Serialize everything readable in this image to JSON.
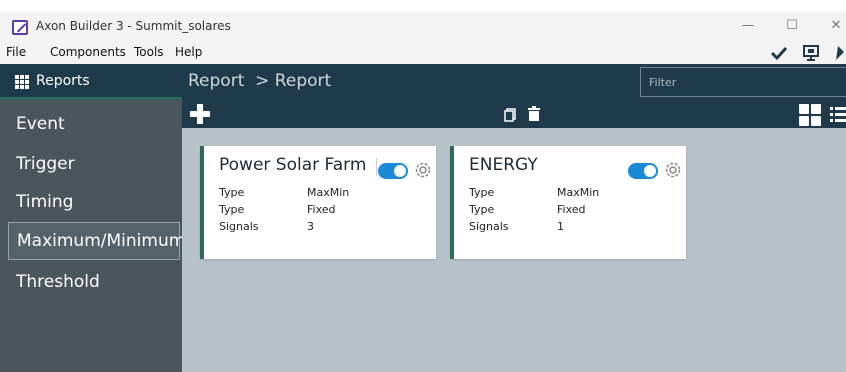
{
  "window": {
    "title": "Axon Builder 3 - Summit_solares",
    "minimize": "—",
    "maximize": "☐",
    "close": "✕"
  },
  "menu": {
    "items": [
      "File",
      "Components",
      "Tools",
      "Help"
    ],
    "tools": [
      "check-icon",
      "monitor-icon",
      "pin-icon"
    ]
  },
  "sidebar": {
    "title": "Reports",
    "items": [
      {
        "label": "Event"
      },
      {
        "label": "Trigger"
      },
      {
        "label": "Timing"
      },
      {
        "label": "Maximum/Minimum",
        "active": true
      },
      {
        "label": "Threshold"
      }
    ]
  },
  "header": {
    "breadcrumb": "Report  > Report",
    "filter_placeholder": "Filter"
  },
  "cards": [
    {
      "title": "Power Solar Farm",
      "enabled": true,
      "rows": [
        {
          "key": "Type",
          "value": "MaxMin"
        },
        {
          "key": "Type",
          "value": "Fixed"
        },
        {
          "key": "Signals",
          "value": "3"
        }
      ]
    },
    {
      "title": "ENERGY",
      "enabled": true,
      "rows": [
        {
          "key": "Type",
          "value": "MaxMin"
        },
        {
          "key": "Type",
          "value": "Fixed"
        },
        {
          "key": "Signals",
          "value": "1"
        }
      ]
    }
  ],
  "colors": {
    "header": "#1f3a4b",
    "sidebar": "#4b565c",
    "accent": "#2f6a5e",
    "toggle": "#1a8ad6",
    "content_bg": "#b7c2c9"
  }
}
